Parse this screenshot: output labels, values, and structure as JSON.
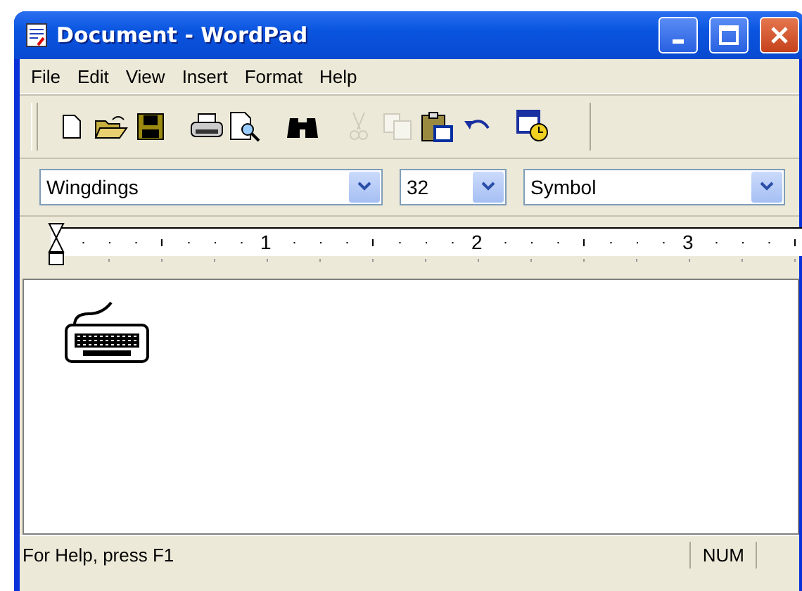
{
  "window": {
    "title": "Document - WordPad"
  },
  "menu": [
    {
      "label": "File"
    },
    {
      "label": "Edit"
    },
    {
      "label": "View"
    },
    {
      "label": "Insert"
    },
    {
      "label": "Format"
    },
    {
      "label": "Help"
    }
  ],
  "toolbar": [
    {
      "kind": "new",
      "disabled": false
    },
    {
      "kind": "open",
      "disabled": false
    },
    {
      "kind": "save",
      "disabled": false
    },
    {
      "kind": "gap"
    },
    {
      "kind": "print",
      "disabled": false
    },
    {
      "kind": "preview",
      "disabled": false
    },
    {
      "kind": "gap"
    },
    {
      "kind": "find",
      "disabled": false
    },
    {
      "kind": "gap"
    },
    {
      "kind": "cut",
      "disabled": true
    },
    {
      "kind": "copy",
      "disabled": true
    },
    {
      "kind": "paste",
      "disabled": false
    },
    {
      "kind": "undo",
      "disabled": false
    },
    {
      "kind": "gap"
    },
    {
      "kind": "datetime",
      "disabled": false
    }
  ],
  "format_bar": {
    "font": "Wingdings",
    "size": "32",
    "script": "Symbol"
  },
  "ruler": {
    "labels": [
      "1",
      "2",
      "3"
    ]
  },
  "status_bar": {
    "help": "For Help, press F1",
    "num": "NUM"
  }
}
